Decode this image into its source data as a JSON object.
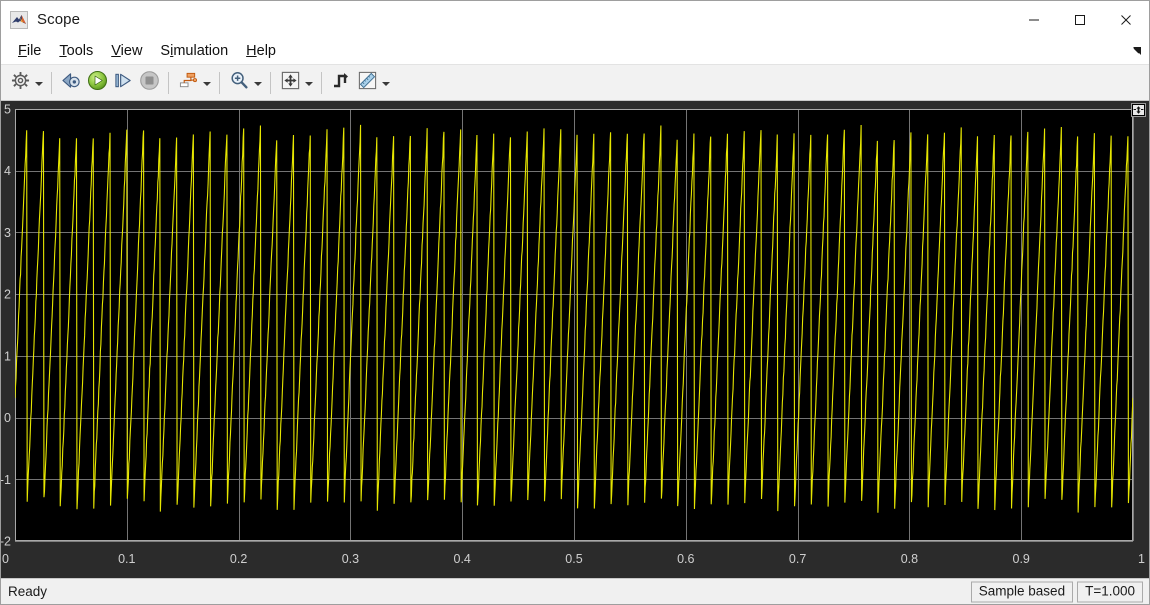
{
  "window": {
    "title": "Scope",
    "icon": "matlab-logo-icon",
    "controls": [
      {
        "name": "minimize-button",
        "glyph": "minimize-icon"
      },
      {
        "name": "maximize-button",
        "glyph": "maximize-icon"
      },
      {
        "name": "close-button",
        "glyph": "close-icon"
      }
    ]
  },
  "menubar": {
    "items": [
      {
        "label": "File",
        "mnemonic_index": 0
      },
      {
        "label": "Tools",
        "mnemonic_index": 0
      },
      {
        "label": "View",
        "mnemonic_index": 0
      },
      {
        "label": "Simulation",
        "mnemonic_index": 1
      },
      {
        "label": "Help",
        "mnemonic_index": 0
      }
    ],
    "expand_icon": "menu-overflow-arrow-icon"
  },
  "toolbar": {
    "groups": [
      {
        "buttons": [
          {
            "name": "configuration-properties-button",
            "icon": "gear-icon",
            "has_caret": true
          }
        ]
      },
      {
        "buttons": [
          {
            "name": "step-back-button",
            "icon": "step-back-icon",
            "has_caret": false
          },
          {
            "name": "run-button",
            "icon": "play-icon",
            "has_caret": false
          },
          {
            "name": "step-forward-button",
            "icon": "step-forward-icon",
            "has_caret": false
          },
          {
            "name": "stop-button",
            "icon": "stop-icon",
            "has_caret": false
          }
        ]
      },
      {
        "buttons": [
          {
            "name": "signal-selection-button",
            "icon": "signal-hierarchy-icon",
            "has_caret": true
          }
        ]
      },
      {
        "buttons": [
          {
            "name": "zoom-in-button",
            "icon": "zoom-in-magnifier-icon",
            "has_caret": true
          }
        ]
      },
      {
        "buttons": [
          {
            "name": "autoscale-button",
            "icon": "autoscale-arrows-icon",
            "has_caret": true
          }
        ]
      },
      {
        "buttons": [
          {
            "name": "trigger-button",
            "icon": "trigger-waveform-icon",
            "has_caret": false
          },
          {
            "name": "measurements-button",
            "icon": "ruler-icon",
            "has_caret": true
          }
        ]
      }
    ]
  },
  "scope": {
    "expand_icon": "expand-plot-icon",
    "background_color": "#000000",
    "panel_color": "#2b2b2b",
    "grid_color": "#9b9b9b",
    "trace_color": "#e6e600",
    "axis_text_color": "#cfcfcf"
  },
  "statusbar": {
    "message": "Ready",
    "cells": [
      {
        "name": "sample-mode-cell",
        "text": "Sample based"
      },
      {
        "name": "simulation-time-cell",
        "text": "T=1.000"
      }
    ]
  },
  "chart_data": {
    "type": "line",
    "title": "",
    "xlabel": "",
    "ylabel": "",
    "xlim": [
      0,
      1
    ],
    "ylim": [
      -2,
      5
    ],
    "xticks": [
      0,
      0.1,
      0.2,
      0.3,
      0.4,
      0.5,
      0.6,
      0.7,
      0.8,
      0.9,
      1
    ],
    "xtick_labels": [
      "0",
      "0.1",
      "0.2",
      "0.3",
      "0.4",
      "0.5",
      "0.6",
      "0.7",
      "0.8",
      "0.9",
      "1"
    ],
    "yticks": [
      -2,
      -1,
      0,
      1,
      2,
      3,
      4,
      5
    ],
    "ytick_labels": [
      "-2",
      "-1",
      "0",
      "1",
      "2",
      "3",
      "4",
      "5"
    ],
    "grid": true,
    "legend": null,
    "series": [
      {
        "name": "sawtooth",
        "color": "#e6e600",
        "waveform": "sawtooth",
        "amplitude_min": -1.5,
        "amplitude_max": 4.7,
        "frequency_hz": 67,
        "cycles_visible": 67,
        "initial_value": 0.3,
        "noise_amplitude": 0.12,
        "sample_count": 2200
      }
    ]
  }
}
